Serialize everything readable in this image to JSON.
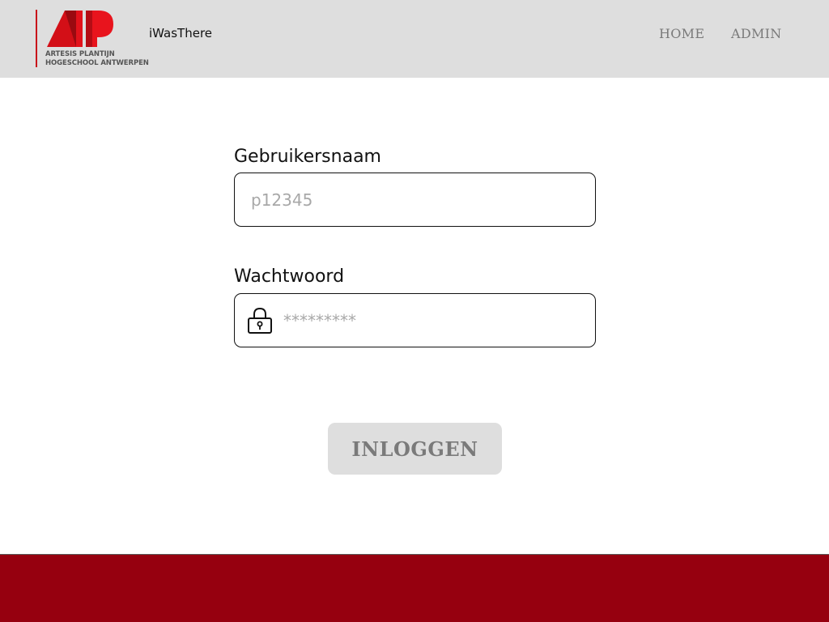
{
  "header": {
    "logo": {
      "line1": "ARTESIS PLANTIJN",
      "line2": "HOGESCHOOL ANTWERPEN"
    },
    "app_title": "iWasThere",
    "nav": {
      "home": "HOME",
      "admin": "ADMIN"
    }
  },
  "form": {
    "username": {
      "label": "Gebruikersnaam",
      "placeholder": "p12345",
      "value": ""
    },
    "password": {
      "label": "Wachtwoord",
      "placeholder": "*********",
      "value": ""
    },
    "submit_label": "INLOGGEN"
  },
  "colors": {
    "header_bg": "#dedede",
    "brand_red": "#c8101a",
    "footer_red": "#96000f",
    "button_bg": "#dedede",
    "muted_text": "#7a7a7a"
  },
  "icons": {
    "password_field": "lock-icon"
  }
}
